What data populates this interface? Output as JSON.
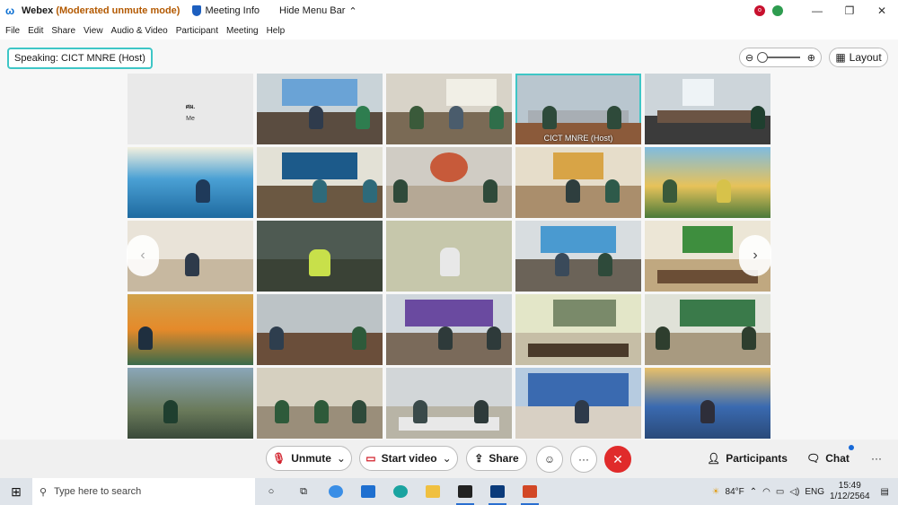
{
  "window": {
    "app_name": "Webex",
    "mode": "(Moderated unmute mode)",
    "meeting_info": "Meeting Info",
    "hide_menu": "Hide Menu Bar"
  },
  "menu": [
    "File",
    "Edit",
    "Share",
    "View",
    "Audio & Video",
    "Participant",
    "Meeting",
    "Help"
  ],
  "speaking": "Speaking: CICT MNRE (Host)",
  "layout_label": "Layout",
  "me_tile": {
    "initials": "ศผ.",
    "label": "Me"
  },
  "host_label": "CICT MNRE  (Host)",
  "controls": {
    "unmute": "Unmute",
    "start_video": "Start video",
    "share": "Share",
    "participants": "Participants",
    "chat": "Chat"
  },
  "taskbar": {
    "search_placeholder": "Type here to search",
    "temperature": "84°F",
    "language": "ENG",
    "time": "15:49",
    "date": "1/12/2564"
  },
  "colors": {
    "accent": "#3ec6c6",
    "leave": "#e02b2b",
    "mute_red": "#d2222d"
  }
}
